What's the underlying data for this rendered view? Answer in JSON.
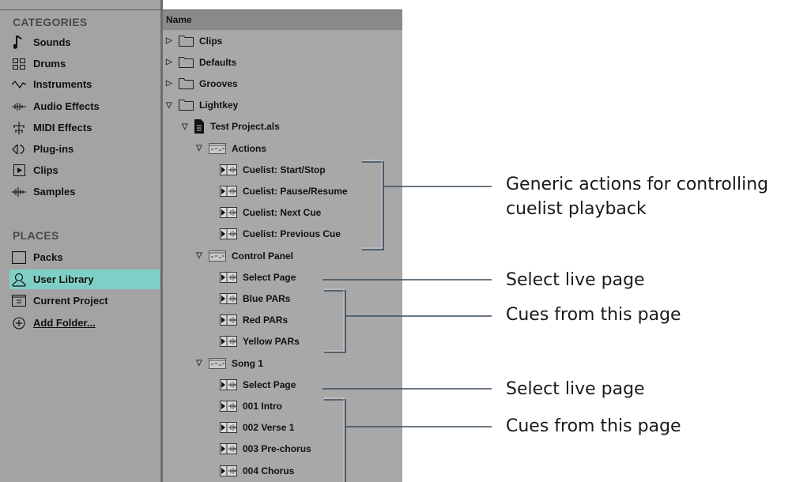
{
  "left_panel": {
    "categories_heading": "CATEGORIES",
    "categories": [
      {
        "label": "Sounds",
        "icon": "music-note-icon"
      },
      {
        "label": "Drums",
        "icon": "drum-grid-icon"
      },
      {
        "label": "Instruments",
        "icon": "waveform-icon"
      },
      {
        "label": "Audio Effects",
        "icon": "audio-effects-icon"
      },
      {
        "label": "MIDI Effects",
        "icon": "midi-effects-icon"
      },
      {
        "label": "Plug-ins",
        "icon": "plugin-icon"
      },
      {
        "label": "Clips",
        "icon": "clip-play-icon"
      },
      {
        "label": "Samples",
        "icon": "samples-icon"
      }
    ],
    "places_heading": "PLACES",
    "places": [
      {
        "label": "Packs",
        "icon": "packs-icon"
      },
      {
        "label": "User Library",
        "icon": "user-icon",
        "selected": true
      },
      {
        "label": "Current Project",
        "icon": "project-icon"
      },
      {
        "label": "Add Folder...",
        "icon": "add-circle-icon"
      }
    ],
    "selected_color": "#7ed0c6"
  },
  "tree": {
    "header": "Name",
    "rows": [
      {
        "label": "Clips",
        "type": "folder",
        "expanded": false
      },
      {
        "label": "Defaults",
        "type": "folder",
        "expanded": false
      },
      {
        "label": "Grooves",
        "type": "folder",
        "expanded": false
      },
      {
        "label": "Lightkey",
        "type": "folder",
        "expanded": true
      },
      {
        "label": "Test Project.als",
        "type": "file",
        "expanded": true
      },
      {
        "label": "Actions",
        "type": "group",
        "expanded": true
      },
      {
        "label": "Cuelist: Start/Stop",
        "type": "clip"
      },
      {
        "label": "Cuelist: Pause/Resume",
        "type": "clip"
      },
      {
        "label": "Cuelist: Next Cue",
        "type": "clip"
      },
      {
        "label": "Cuelist: Previous Cue",
        "type": "clip"
      },
      {
        "label": "Control Panel",
        "type": "group",
        "expanded": true
      },
      {
        "label": "Select Page",
        "type": "clip"
      },
      {
        "label": "Blue PARs",
        "type": "clip"
      },
      {
        "label": "Red PARs",
        "type": "clip"
      },
      {
        "label": "Yellow PARs",
        "type": "clip"
      },
      {
        "label": "Song 1",
        "type": "group",
        "expanded": true
      },
      {
        "label": "Select Page",
        "type": "clip"
      },
      {
        "label": "001 Intro",
        "type": "clip"
      },
      {
        "label": "002 Verse 1",
        "type": "clip"
      },
      {
        "label": "003 Pre-chorus",
        "type": "clip"
      },
      {
        "label": "004 Chorus",
        "type": "clip"
      }
    ]
  },
  "annotations": {
    "generic_actions": "Generic actions for controlling\ncuelist playback",
    "select_live_page_1": "Select live page",
    "cues_from_page_1": "Cues from this page",
    "select_live_page_2": "Select live page",
    "cues_from_page_2": "Cues from this page"
  }
}
